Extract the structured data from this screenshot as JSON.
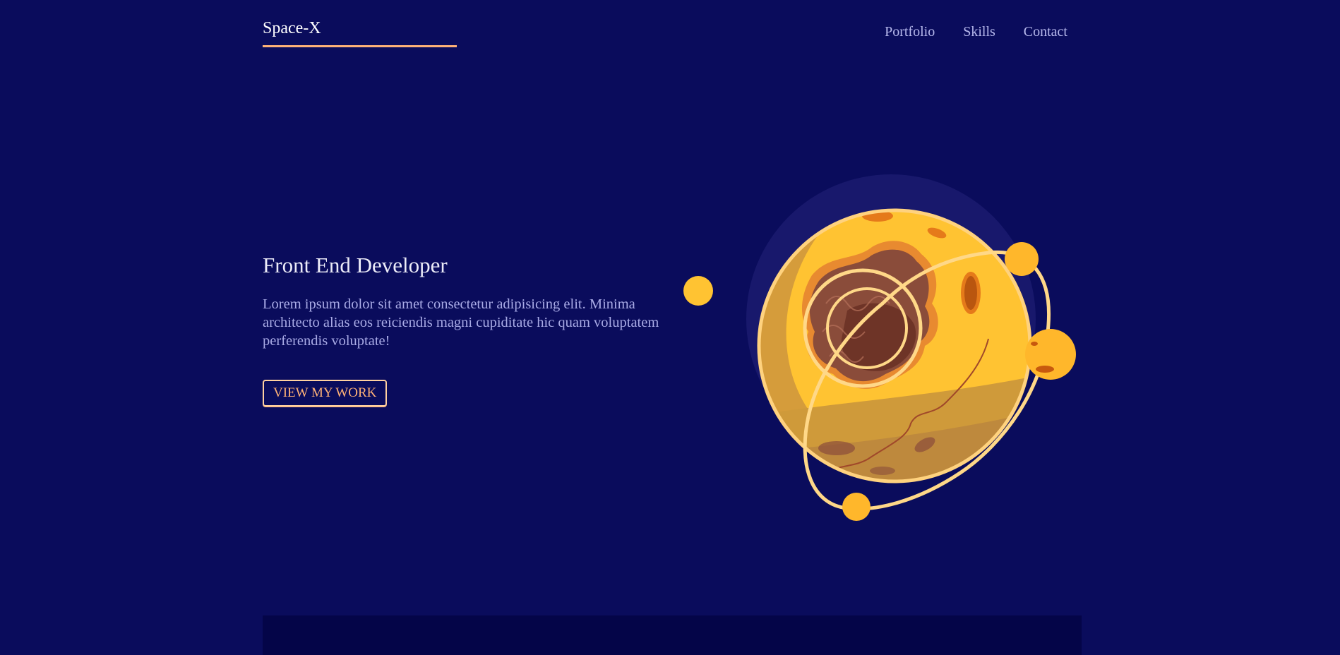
{
  "header": {
    "logo": "Space-X",
    "nav": [
      "Portfolio",
      "Skills",
      "Contact"
    ]
  },
  "hero": {
    "title": "Front End Developer",
    "description": "Lorem ipsum dolor sit amet consectetur adipisicing elit. Minima architecto alias eos reiciendis magni cupiditate hic quam voluptatem perferendis voluptate!",
    "cta_label": "VIEW MY WORK"
  },
  "colors": {
    "background": "#0a0c5c",
    "accent": "#ffb277",
    "planet": "#ffc332",
    "bottom_panel": "#040548"
  },
  "illustration": "planet-with-orbit-rings"
}
